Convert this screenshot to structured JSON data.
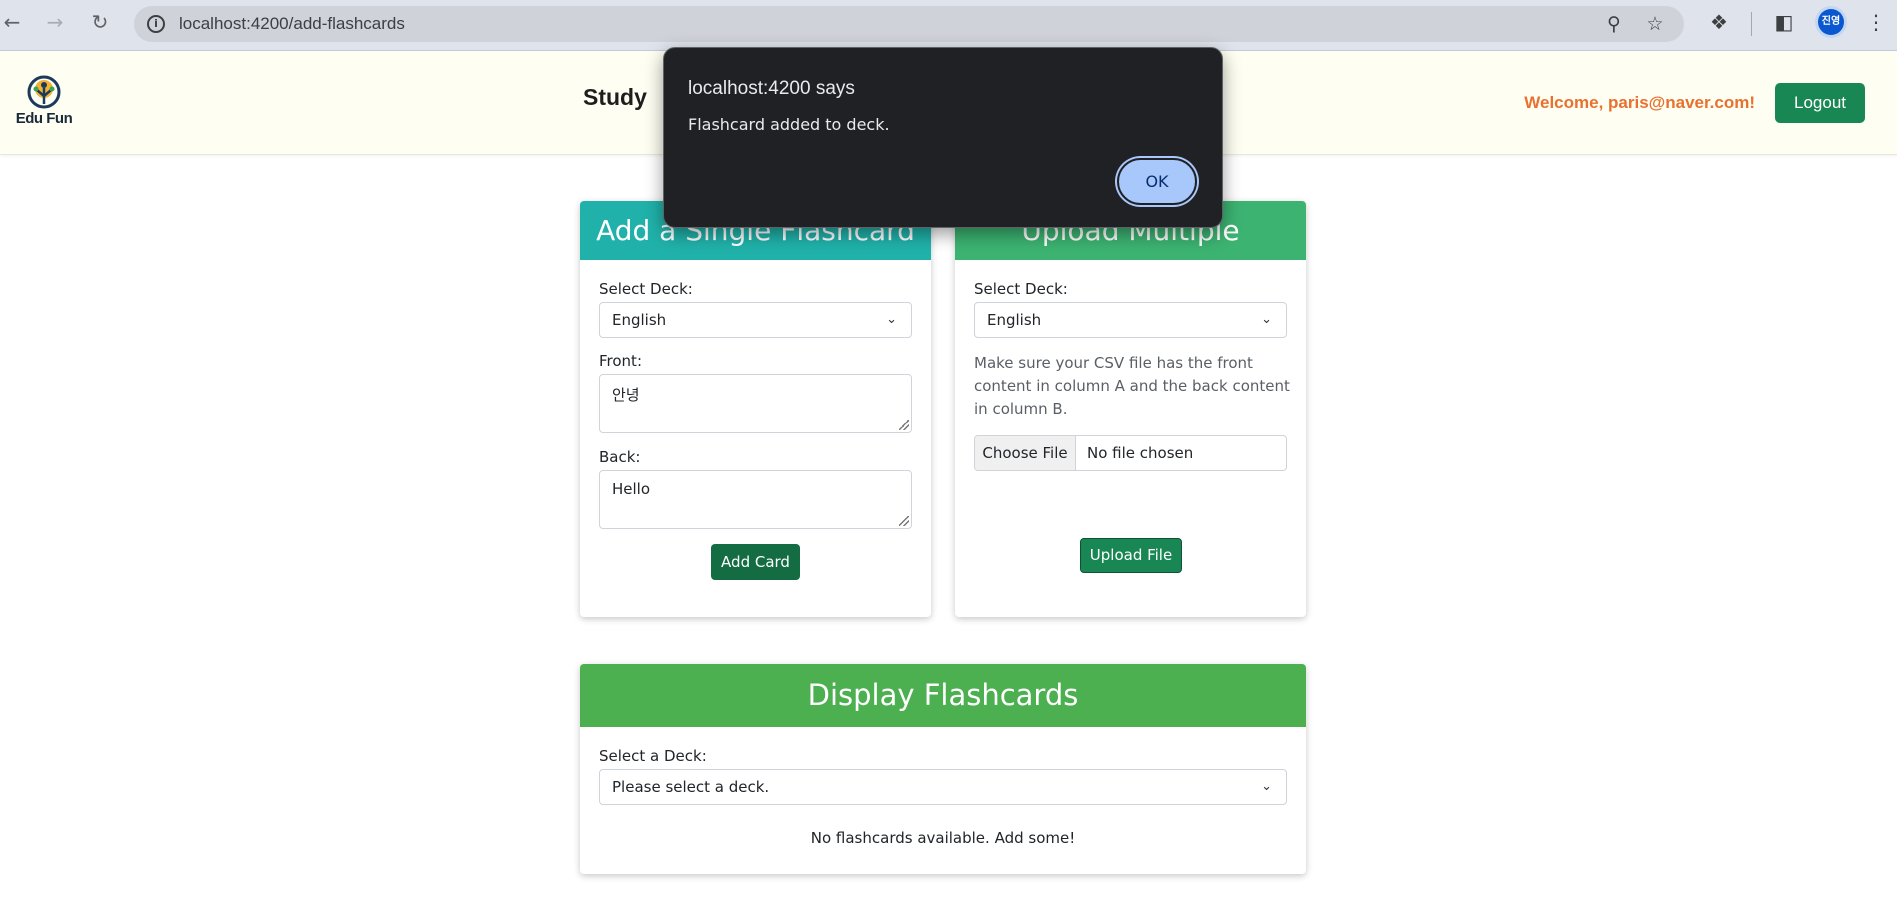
{
  "browser": {
    "url": "localhost:4200/add-flashcards",
    "profile_initials": "진영"
  },
  "navbar": {
    "logo_text": "Edu Fun",
    "study_label": "Study",
    "welcome_text": "Welcome, paris@naver.com!",
    "logout_label": "Logout"
  },
  "single_card": {
    "title": "Add a Single Flashcard",
    "deck_label": "Select Deck:",
    "deck_value": "English",
    "front_label": "Front:",
    "front_value": "안녕",
    "back_label": "Back:",
    "back_value": "Hello",
    "add_button": "Add Card",
    "header_color": "#20b2aa"
  },
  "multi_card": {
    "title": "Upload Multiple Flashcards",
    "deck_label": "Select Deck:",
    "deck_value": "English",
    "hint": "Make sure your CSV file has the front content in column A and the back content in column B.",
    "choose_file_label": "Choose File",
    "file_status": "No file chosen",
    "upload_button": "Upload File",
    "header_color": "#3cb371"
  },
  "display_card": {
    "title": "Display Flashcards",
    "deck_label": "Select a Deck:",
    "deck_placeholder": "Please select a deck.",
    "empty_message": "No flashcards available. Add some!",
    "header_color": "#4caf50"
  },
  "dialog": {
    "title": "localhost:4200 says",
    "message": "Flashcard added to deck.",
    "ok_label": "OK"
  }
}
